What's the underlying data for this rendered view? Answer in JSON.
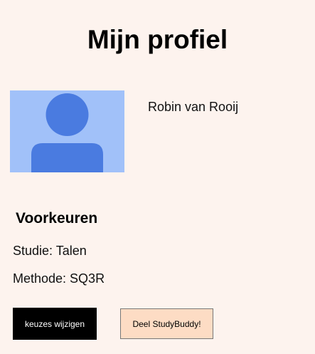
{
  "page": {
    "title": "Mijn profiel"
  },
  "profile": {
    "avatar_icon": "person-placeholder-icon",
    "name": "Robin van Rooij"
  },
  "preferences": {
    "heading": "Voorkeuren",
    "study": "Studie: Talen",
    "method": "Methode: SQ3R"
  },
  "actions": {
    "edit_label": "keuzes wijzigen",
    "share_label": "Deel StudyBuddy!"
  },
  "colors": {
    "background": "#fdf3ee",
    "avatar_bg": "#a1c1f9",
    "avatar_fg": "#4a7be0",
    "primary_button": "#000000",
    "secondary_button": "#fddcc4"
  }
}
